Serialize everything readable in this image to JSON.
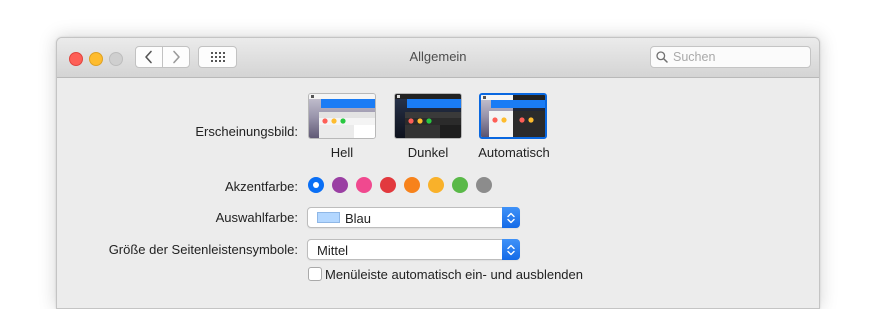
{
  "window": {
    "title": "Allgemein",
    "search_placeholder": "Suchen"
  },
  "appearance": {
    "label": "Erscheinungsbild:",
    "options": [
      {
        "name": "Hell",
        "selected": false
      },
      {
        "name": "Dunkel",
        "selected": false
      },
      {
        "name": "Automatisch",
        "selected": true
      }
    ]
  },
  "accent": {
    "label": "Akzentfarbe:",
    "colors": [
      "#0a6ff5",
      "#9a3fa3",
      "#f0498f",
      "#e2393e",
      "#f7821b",
      "#f9b12a",
      "#5ab948",
      "#8c8c8c"
    ],
    "selected_index": 0
  },
  "highlight": {
    "label": "Auswahlfarbe:",
    "value": "Blau",
    "swatch_color": "#b3d7ff"
  },
  "sidebar_icon_size": {
    "label": "Größe der Seitenleistensymbole:",
    "value": "Mittel"
  },
  "menubar": {
    "label": "Menüleiste automatisch ein- und ausblenden",
    "checked": false
  }
}
